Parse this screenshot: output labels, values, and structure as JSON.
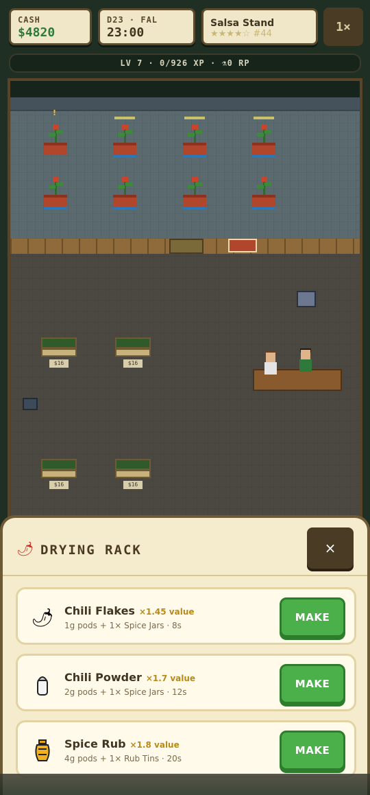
{
  "hud": {
    "cash_label": "CASH",
    "cash_value": "$4820",
    "date_label": "D23 · FAL",
    "time_value": "23:00",
    "shop_name": "Salsa Stand",
    "shop_stars": "★★★★☆",
    "shop_rank": "#44",
    "speed_label": "1×",
    "xp_text": "LV 7 · 0/926 XP · ⚗0 RP"
  },
  "scene": {
    "price_tag": "$16",
    "alert_mark": "!"
  },
  "panel": {
    "icon": "chili-pepper-icon",
    "title": "DRYING RACK",
    "close_label": "×",
    "recipes": [
      {
        "icon": "chili-pepper-icon",
        "name": "Chili Flakes",
        "multiplier": "×1.45 value",
        "requirements": "1g pods + 1× Spice Jars · 8s",
        "button": "MAKE"
      },
      {
        "icon": "salt-shaker-icon",
        "name": "Chili Powder",
        "multiplier": "×1.7 value",
        "requirements": "2g pods + 1× Spice Jars · 12s",
        "button": "MAKE"
      },
      {
        "icon": "amphora-icon",
        "name": "Spice Rub",
        "multiplier": "×1.8 value",
        "requirements": "4g pods + 1× Rub Tins · 20s",
        "button": "MAKE"
      }
    ]
  },
  "colors": {
    "accent_green": "#4cb04a",
    "panel_bg": "#f5ebcd",
    "dark_brown": "#4a3b25",
    "value_gold": "#b88a1a"
  }
}
